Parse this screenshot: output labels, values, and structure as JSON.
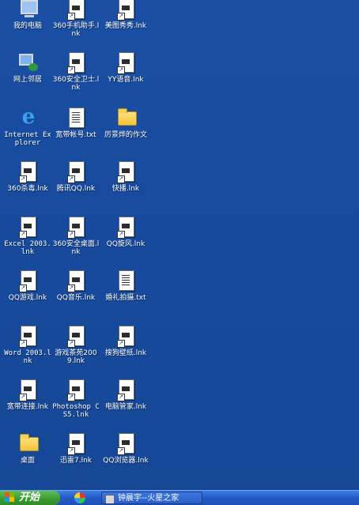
{
  "desktop": {
    "icons": [
      {
        "label": "我的电脑",
        "type": "computer",
        "col": 0,
        "row": 0
      },
      {
        "label": "360手机助手.lnk",
        "type": "shortcut",
        "col": 1,
        "row": 0
      },
      {
        "label": "美图秀秀.lnk",
        "type": "shortcut",
        "col": 2,
        "row": 0
      },
      {
        "label": "网上邻居",
        "type": "network",
        "col": 0,
        "row": 1
      },
      {
        "label": "360安全卫士.lnk",
        "type": "shortcut",
        "col": 1,
        "row": 1
      },
      {
        "label": "YY语音.lnk",
        "type": "shortcut",
        "col": 2,
        "row": 1
      },
      {
        "label": "Internet Explorer",
        "type": "ie",
        "col": 0,
        "row": 2
      },
      {
        "label": "宽带帐号.txt",
        "type": "txt",
        "col": 1,
        "row": 2
      },
      {
        "label": "厉景烨的作文",
        "type": "folder",
        "col": 2,
        "row": 2
      },
      {
        "label": "360杀毒.lnk",
        "type": "shortcut",
        "col": 0,
        "row": 3
      },
      {
        "label": "腾讯QQ.lnk",
        "type": "shortcut",
        "col": 1,
        "row": 3
      },
      {
        "label": "快播.lnk",
        "type": "shortcut",
        "col": 2,
        "row": 3
      },
      {
        "label": "Excel 2003.lnk",
        "type": "shortcut",
        "col": 0,
        "row": 4
      },
      {
        "label": "360安全桌面.lnk",
        "type": "shortcut",
        "col": 1,
        "row": 4
      },
      {
        "label": "QQ旋风.lnk",
        "type": "shortcut",
        "col": 2,
        "row": 4
      },
      {
        "label": "QQ游戏.lnk",
        "type": "shortcut",
        "col": 0,
        "row": 5
      },
      {
        "label": "QQ音乐.lnk",
        "type": "shortcut",
        "col": 1,
        "row": 5
      },
      {
        "label": "婚礼拍摄.txt",
        "type": "txt",
        "col": 2,
        "row": 5
      },
      {
        "label": "Word 2003.lnk",
        "type": "shortcut",
        "col": 0,
        "row": 6
      },
      {
        "label": "游戏茶苑2009.lnk",
        "type": "shortcut",
        "col": 1,
        "row": 6
      },
      {
        "label": "搜狗壁纸.lnk",
        "type": "shortcut",
        "col": 2,
        "row": 6
      },
      {
        "label": "宽带连接.lnk",
        "type": "shortcut",
        "col": 0,
        "row": 7
      },
      {
        "label": "Photoshop CS5.lnk",
        "type": "shortcut",
        "col": 1,
        "row": 7
      },
      {
        "label": "电脑管家.lnk",
        "type": "shortcut",
        "col": 2,
        "row": 7
      },
      {
        "label": "桌面",
        "type": "folder",
        "col": 0,
        "row": 8
      },
      {
        "label": "迅雷7.lnk",
        "type": "shortcut",
        "col": 1,
        "row": 8
      },
      {
        "label": "QQ浏览器.lnk",
        "type": "shortcut",
        "col": 2,
        "row": 8
      }
    ]
  },
  "taskbar": {
    "start_label": "开始",
    "quick_launch_icon": "360-icon",
    "task_window_label": "钟晨宇--火星之家"
  },
  "colors": {
    "desktop_bg": "#1a4fa3",
    "taskbar_bg": "#2459c6",
    "start_green": "#3a9a2e"
  }
}
